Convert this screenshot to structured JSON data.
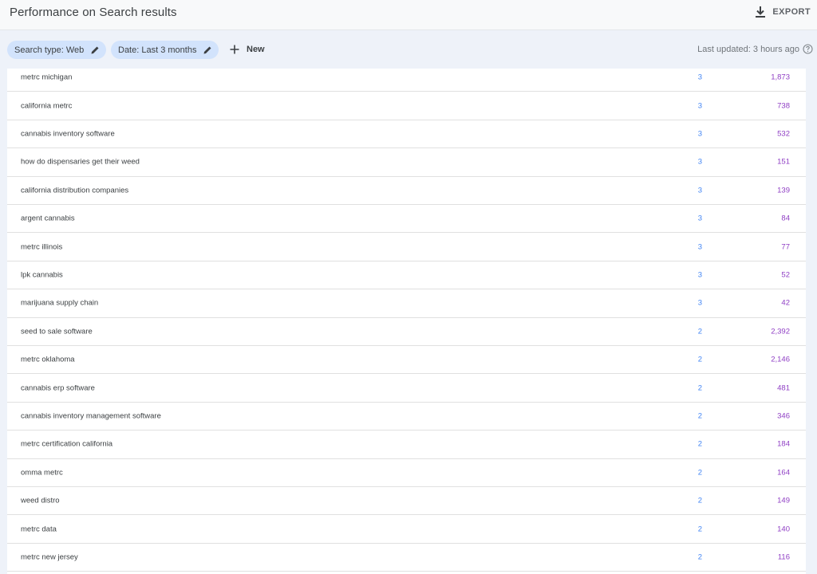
{
  "header": {
    "title": "Performance on Search results",
    "export_label": "EXPORT"
  },
  "filters": {
    "chips": [
      {
        "label": "Search type: Web"
      },
      {
        "label": "Date: Last 3 months"
      }
    ],
    "new_label": "New",
    "last_updated": "Last updated: 3 hours ago"
  },
  "colors": {
    "clicks": "#4285f4",
    "impressions": "#8f3ec4",
    "chip_bg": "#d2e3fc"
  },
  "table": {
    "rows": [
      {
        "query": "metrc michigan",
        "clicks": "3",
        "impressions": "1,873"
      },
      {
        "query": "california metrc",
        "clicks": "3",
        "impressions": "738"
      },
      {
        "query": "cannabis inventory software",
        "clicks": "3",
        "impressions": "532"
      },
      {
        "query": "how do dispensaries get their weed",
        "clicks": "3",
        "impressions": "151"
      },
      {
        "query": "california distribution companies",
        "clicks": "3",
        "impressions": "139"
      },
      {
        "query": "argent cannabis",
        "clicks": "3",
        "impressions": "84"
      },
      {
        "query": "metrc illinois",
        "clicks": "3",
        "impressions": "77"
      },
      {
        "query": "lpk cannabis",
        "clicks": "3",
        "impressions": "52"
      },
      {
        "query": "marijuana supply chain",
        "clicks": "3",
        "impressions": "42"
      },
      {
        "query": "seed to sale software",
        "clicks": "2",
        "impressions": "2,392"
      },
      {
        "query": "metrc oklahoma",
        "clicks": "2",
        "impressions": "2,146"
      },
      {
        "query": "cannabis erp software",
        "clicks": "2",
        "impressions": "481"
      },
      {
        "query": "cannabis inventory management software",
        "clicks": "2",
        "impressions": "346"
      },
      {
        "query": "metrc certification california",
        "clicks": "2",
        "impressions": "184"
      },
      {
        "query": "omma metrc",
        "clicks": "2",
        "impressions": "164"
      },
      {
        "query": "weed distro",
        "clicks": "2",
        "impressions": "149"
      },
      {
        "query": "metrc data",
        "clicks": "2",
        "impressions": "140"
      },
      {
        "query": "metrc new jersey",
        "clicks": "2",
        "impressions": "116"
      }
    ]
  }
}
